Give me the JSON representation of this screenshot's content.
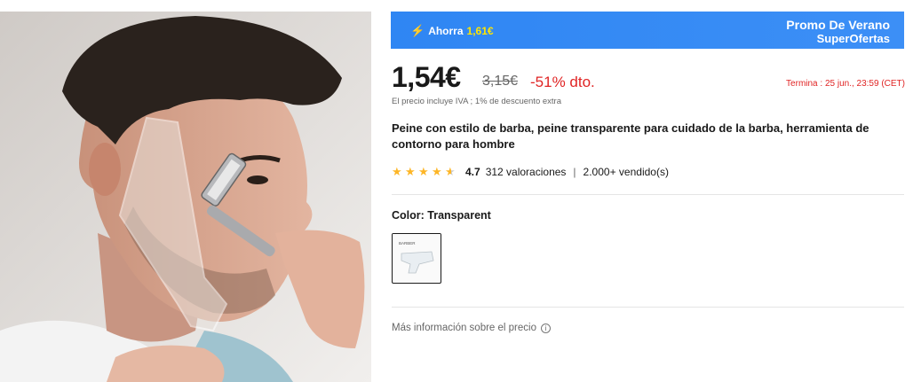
{
  "promo": {
    "save_label": "Ahorra",
    "save_amount": "1,61€",
    "name_line1": "Promo De Verano",
    "name_line2": "SuperOfertas",
    "bolt_icon": "lightning-bolt-icon",
    "bg_color": "#3c8ff6",
    "highlight_color": "#ffe600"
  },
  "price": {
    "current": "1,54€",
    "original": "3,15€",
    "discount": "-51% dto.",
    "ends": "Termina :  25 jun., 23:59 (CET)",
    "vat_note": "El precio incluye IVA ; 1% de descuento extra",
    "accent_color": "#e02424"
  },
  "product": {
    "title": "Peine con estilo de barba, peine transparente para cuidado de la barba, herramienta de contorno para hombre"
  },
  "rating": {
    "stars": 4.5,
    "score": "4.7",
    "reviews": "312 valoraciones",
    "sold": "2.000+ vendido(s)",
    "separator": "|",
    "star_color": "#fdb627"
  },
  "color": {
    "label": "Color: Transparent",
    "swatch_caption": "BARBER",
    "selected": "Transparent"
  },
  "more_info": {
    "label": "Más información sobre el precio",
    "icon": "info-icon"
  }
}
